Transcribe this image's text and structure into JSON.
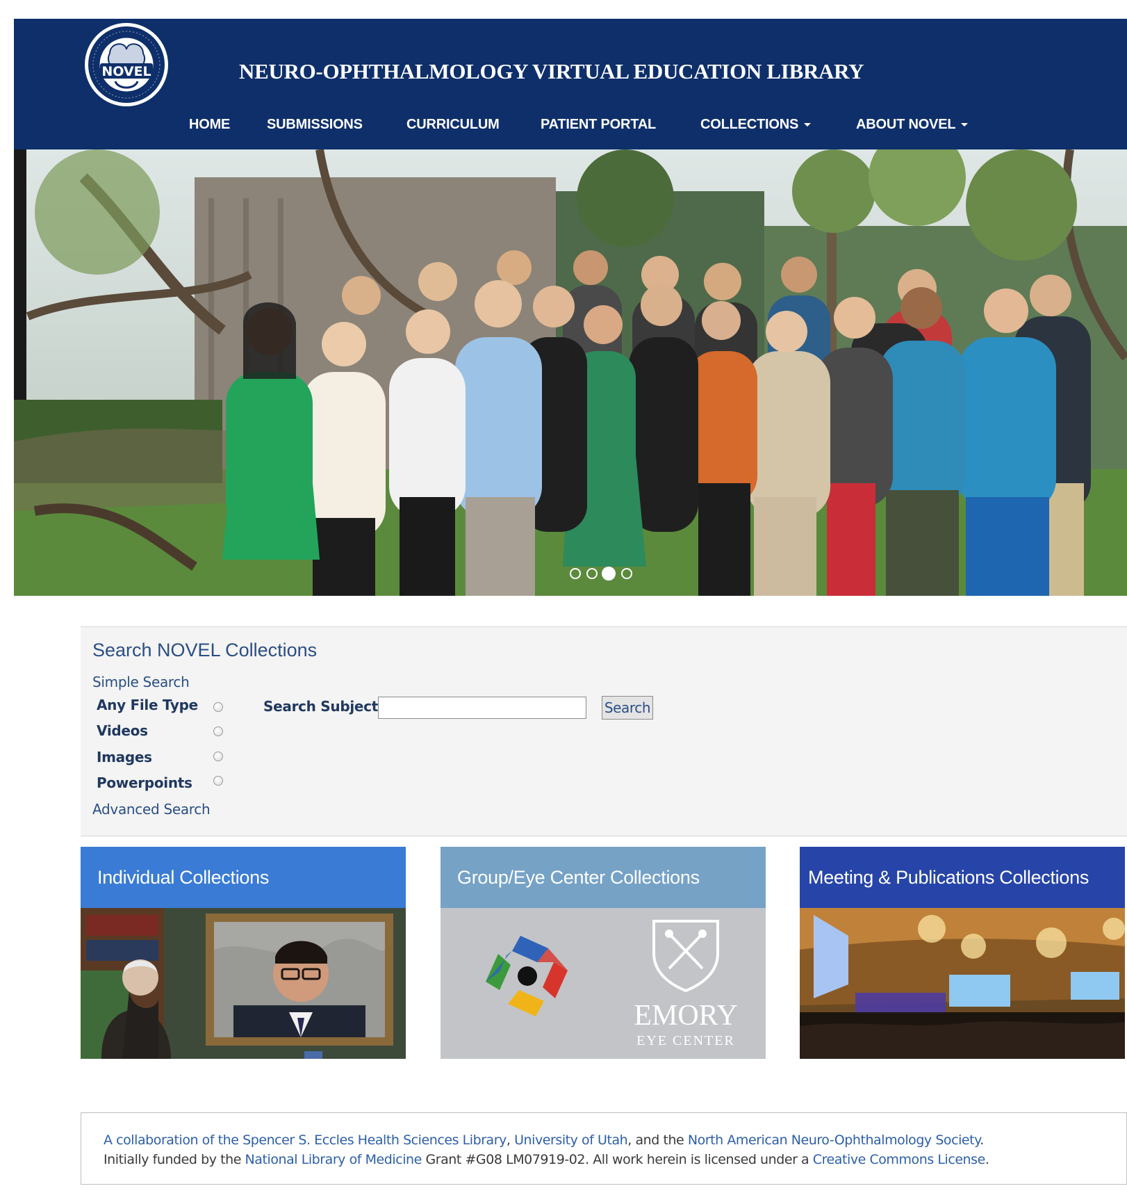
{
  "header": {
    "logo_text": "NOVEL",
    "site_title": "NEURO-OPHTHALMOLOGY VIRTUAL EDUCATION LIBRARY",
    "nav": {
      "home": "HOME",
      "submissions": "SUBMISSIONS",
      "curriculum": "CURRICULUM",
      "patient_portal": "PATIENT PORTAL",
      "collections": "COLLECTIONS",
      "about": "ABOUT NOVEL"
    }
  },
  "carousel": {
    "slide_count": 4,
    "active_index": 2
  },
  "search": {
    "heading": "Search NOVEL Collections",
    "simple_search": "Simple Search",
    "types": [
      "Any File Type",
      "Videos",
      "Images",
      "Powerpoints"
    ],
    "subject_label": "Search Subject",
    "subject_value": "",
    "button": "Search",
    "advanced_search": "Advanced Search"
  },
  "cards": [
    {
      "title": "Individual Collections",
      "color": "#3a7bd5"
    },
    {
      "title": "Group/Eye Center Collections",
      "color": "#76a2c6"
    },
    {
      "title": "Meeting & Publications Collections",
      "color": "#2745a8"
    }
  ],
  "card_logo": {
    "line1": "EMORY",
    "line2": "EYE CENTER"
  },
  "footer": {
    "l1_t1": "A collaboration of the ",
    "l1_a1": "Spencer S. Eccles Health Sciences Library",
    "l1_t2": ", ",
    "l1_a2": "University of Utah",
    "l1_t3": ", and the ",
    "l1_a3": "North American Neuro-Ophthalmology Society",
    "l1_t4": ".",
    "l2_t1": "Initially funded by the ",
    "l2_a1": "National Library of Medicine",
    "l2_t2": " Grant #G08 LM07919-02. All work herein is licensed under a ",
    "l2_a2": "Creative Commons License",
    "l2_t3": "."
  },
  "colors": {
    "header_bg": "#0e2f6a",
    "link": "#2d5fa7"
  }
}
